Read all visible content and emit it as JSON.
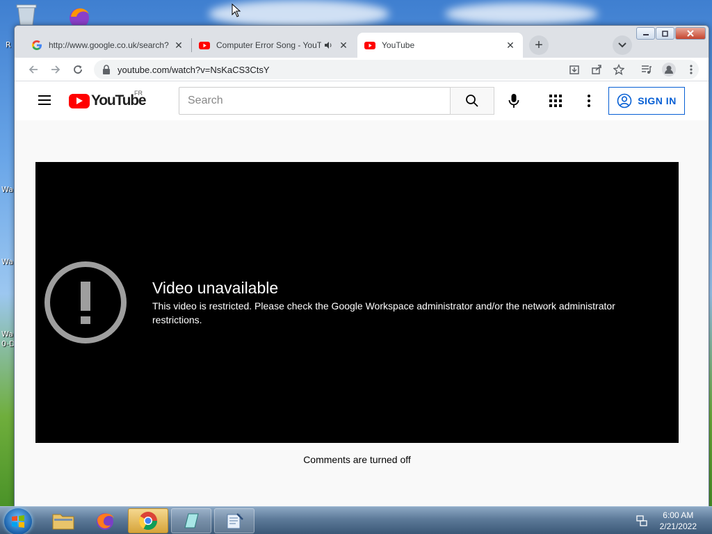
{
  "desktop": {
    "icon_labels": [
      "R",
      "Wa",
      "Wa",
      "Wa",
      "0-D"
    ]
  },
  "browser": {
    "tabs": [
      {
        "title": "http://www.google.co.uk/search?",
        "favicon": "google-icon",
        "active": false
      },
      {
        "title": "Computer Error Song - YouTube",
        "favicon": "youtube-icon",
        "active": false,
        "audio": true
      },
      {
        "title": "YouTube",
        "favicon": "youtube-icon",
        "active": true
      }
    ],
    "close_glyph": "✕",
    "new_tab_glyph": "+",
    "address": "youtube.com/watch?v=NsKaCS3CtsY"
  },
  "youtube": {
    "logo_word": "YouTube",
    "country_code": "FR",
    "search_placeholder": "Search",
    "sign_in_label": "SIGN IN",
    "error_title": "Video unavailable",
    "error_message": "This video is restricted. Please check the Google Workspace administrator and/or the network administrator restrictions.",
    "comments_status": "Comments are turned off"
  },
  "taskbar": {
    "time": "6:00 AM",
    "date": "2/21/2022"
  },
  "colors": {
    "yt_red": "#ff0000",
    "signin_blue": "#065fd4",
    "player_bg": "#000000"
  }
}
